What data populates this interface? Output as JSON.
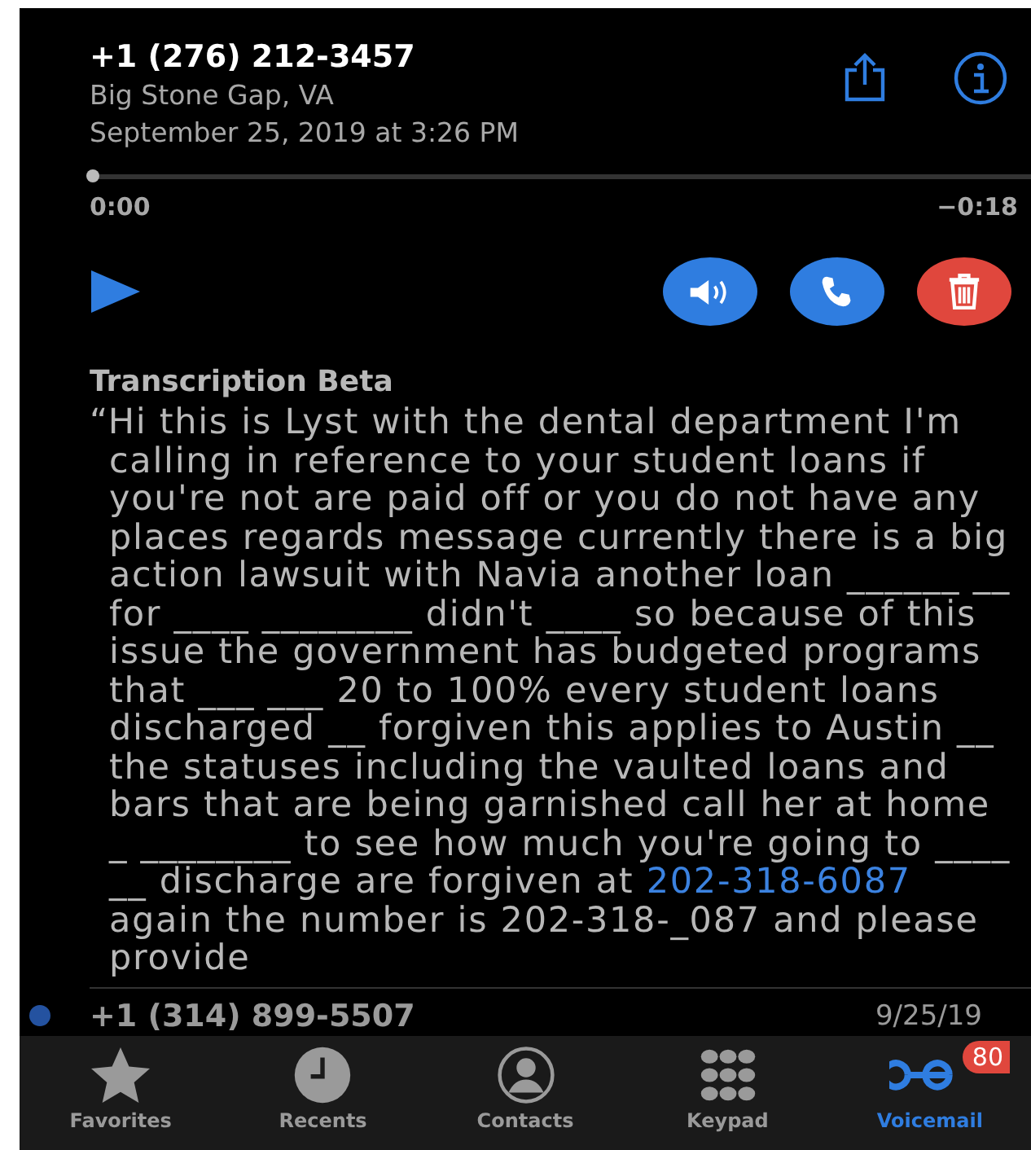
{
  "voicemail": {
    "caller": "+1 (276) 212-3457",
    "location": "Big Stone Gap, VA",
    "date": "September 25, 2019 at 3:26 PM"
  },
  "player": {
    "level": 0,
    "elapsed": "0:00",
    "remaining": "−0:18"
  },
  "transcription": {
    "title": "Transcription Beta",
    "before": "“Hi this is Lyst with the dental department I'm calling in reference to your student loans if you're not are paid off or you do not have any places regards message currently there is a big action lawsuit with Navia another loan ______ __ for ____ ________ didn't ____ so because of this issue the government has budgeted programs that ___ ___ 20 to 100% every student loans discharged __ forgiven this applies to Austin __ the statuses including the vaulted loans and bars that are being garnished call her at home _ ________ to see how much you're going to ____ __ discharge are forgiven at ",
    "link": "202-318-6087",
    "after": " again the number is 202-318-_087 and please provide"
  },
  "next_voicemail": {
    "caller": "+1 (314) 899-5507",
    "date": "9/25/19",
    "unread": true
  },
  "tabs": [
    {
      "label": "Favorites",
      "kind": "star",
      "selected": false
    },
    {
      "label": "Recents",
      "kind": "clock",
      "selected": false
    },
    {
      "label": "Contacts",
      "kind": "person",
      "selected": false
    },
    {
      "label": "Keypad",
      "kind": "keypad",
      "selected": false
    },
    {
      "label": "Voicemail",
      "kind": "voicemail",
      "selected": true,
      "badge": "80"
    }
  ]
}
